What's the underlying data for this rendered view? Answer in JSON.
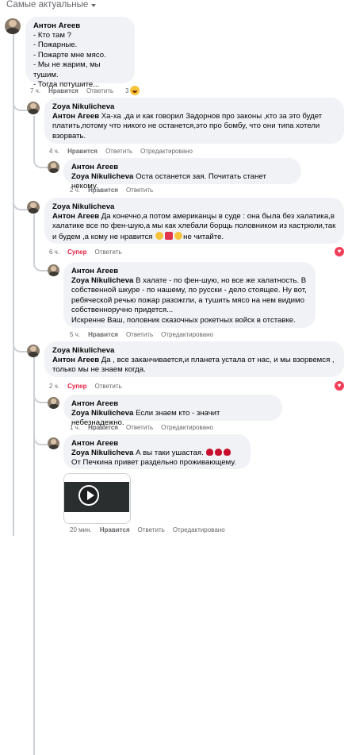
{
  "sort_label": "Самые актуальные",
  "comments": [
    {
      "author": "Антон Агеев",
      "lines": [
        "- Кто там ?",
        "- Пожарные.",
        "- Пожарте мне мясо.",
        "- Мы не жарим, мы тушим.",
        "- Тогда потушите..."
      ],
      "time": "7 ч.",
      "like": "Нравится",
      "reply": "Ответить",
      "reaction_count": "3"
    },
    {
      "author": "Zoya Nikulicheva",
      "mention": "Антон Агеев",
      "text": "Ха-ха ,да и как говорил Задорнов про законы ,кто за это будет платить,потому что никого не останется,это про бомбу, что они типа хотели взорвать.",
      "time": "4 ч.",
      "like": "Нравится",
      "reply": "Ответить",
      "edited": "Отредактировано"
    },
    {
      "author": "Антон Агеев",
      "mention": "Zoya Nikulicheva",
      "text": "Оста останется зая. Почитать станет некому.",
      "time": "2 ч.",
      "like": "Нравится",
      "reply": "Ответить"
    },
    {
      "author": "Zoya Nikulicheva",
      "mention": "Антон Агеев",
      "text": "Да конечно,а потом американцы в суде : она была без халатика,в халатике все по фен-шую,а мы как хлебали борщь половником из кастрюли,так и будем ,а кому не нравится",
      "text_tail": "не читайте.",
      "time": "6 ч.",
      "like": "Супер",
      "reply": "Ответить"
    },
    {
      "author": "Антон Агеев",
      "mention": "Zoya Nikulicheva",
      "text": "В халате - по фен-шую, но все же халатность. В собственной шкуре - по нашему, по русски - дело стоящее. Ну вот, ребяческой речью пожар разожгли, а тушить мясо на нем видимо собственноручно придется...",
      "signature": "Искренне Ваш, половник сказочных рокетных войск в отставке.",
      "time": "5 ч.",
      "like": "Нравится",
      "reply": "Ответить",
      "edited": "Отредактировано"
    },
    {
      "author": "Zoya Nikulicheva",
      "mention": "Антон Агеев",
      "text": "Да , все заканчивается,и планета устала от нас, и мы взорвемся , только мы не знаем когда.",
      "time": "2 ч.",
      "like": "Супер",
      "reply": "Ответить"
    },
    {
      "author": "Антон Агеев",
      "mention": "Zoya Nikulicheva",
      "text": "Если знаем кто - значит небезнадежно.",
      "time": "1 ч.",
      "like": "Нравится",
      "reply": "Ответить",
      "edited": "Отредактировано"
    },
    {
      "author": "Антон Агеев",
      "mention": "Zoya Nikulicheva",
      "text": "А вы таки ушастая.",
      "line2": "От Печкина привет раздельно проживающему.",
      "time": "20 мин.",
      "like": "Нравится",
      "reply": "Ответить",
      "edited": "Отредактировано"
    }
  ],
  "colors": {
    "bubble": "#f0f2f5",
    "meta": "#65676b",
    "super": "#e41e3f",
    "thread": "#ccd0d5"
  }
}
